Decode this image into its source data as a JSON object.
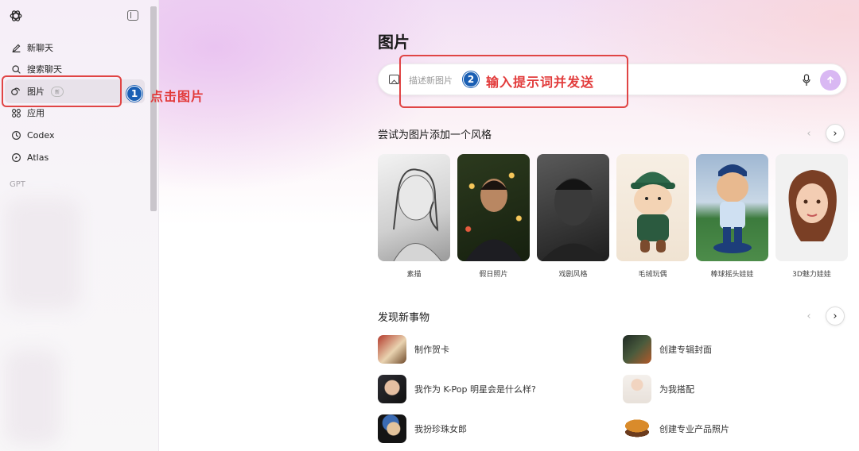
{
  "sidebar": {
    "items": [
      {
        "label": "新聊天",
        "icon": "edit-icon"
      },
      {
        "label": "搜索聊天",
        "icon": "search-icon"
      },
      {
        "label": "图片",
        "icon": "images-icon",
        "badge": "新"
      },
      {
        "label": "应用",
        "icon": "apps-icon"
      },
      {
        "label": "Codex",
        "icon": "codex-icon"
      },
      {
        "label": "Atlas",
        "icon": "atlas-icon"
      }
    ],
    "section_label": "GPT"
  },
  "annotations": {
    "step1_number": "1",
    "step1_text": "点击图片",
    "step2_number": "2",
    "step2_text": "输入提示词并发送",
    "color": "#e04545"
  },
  "main": {
    "title": "图片",
    "search": {
      "placeholder": "描述新图片"
    },
    "styles_section": {
      "title": "尝试为图片添加一个风格",
      "cards": [
        {
          "label": "素描"
        },
        {
          "label": "假日照片"
        },
        {
          "label": "戏剧风格"
        },
        {
          "label": "毛绒玩偶"
        },
        {
          "label": "棒球摇头娃娃"
        },
        {
          "label": "3D魅力娃娃"
        }
      ]
    },
    "discover_section": {
      "title": "发现新事物",
      "items": [
        {
          "label": "制作贺卡"
        },
        {
          "label": "创建专辑封面"
        },
        {
          "label": "我作为 K-Pop 明星会是什么样?"
        },
        {
          "label": "为我搭配"
        },
        {
          "label": "我扮珍珠女郎"
        },
        {
          "label": "创建专业产品照片"
        }
      ]
    },
    "arrows": {
      "prev": "‹",
      "next": "›"
    }
  },
  "colors": {
    "accent": "#d9b8f3",
    "annotation_red": "#e04545",
    "badge_blue": "#1a5fb4"
  }
}
